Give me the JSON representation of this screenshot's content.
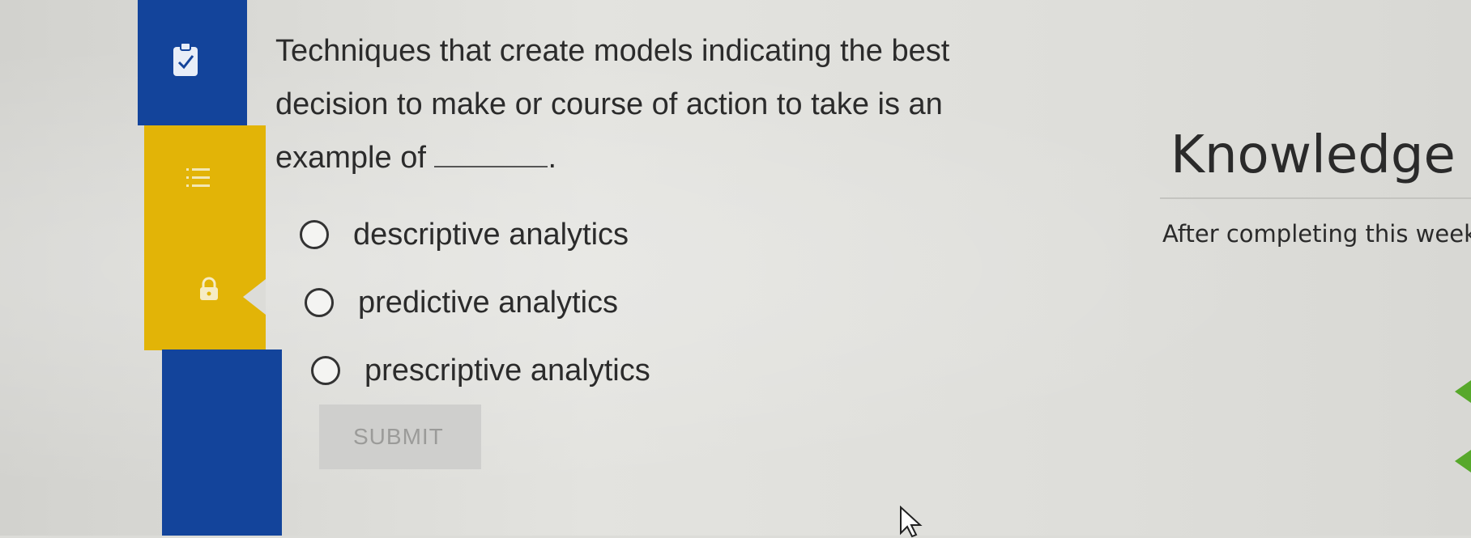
{
  "question": {
    "text_before_blank": "Techniques that create models indicating the best decision to make or course of action to take is an example of",
    "text_after_blank": "."
  },
  "options": [
    {
      "label": "descriptive analytics",
      "selected": false
    },
    {
      "label": "predictive analytics",
      "selected": false
    },
    {
      "label": "prescriptive analytics",
      "selected": false
    }
  ],
  "submit": {
    "label": "SUBMIT",
    "enabled": false
  },
  "side_panel": {
    "title": "Knowledge",
    "text": "After completing this week"
  },
  "sidebar": {
    "icons": [
      "clipboard-check-icon",
      "list-icon",
      "lock-icon"
    ]
  },
  "colors": {
    "sidebar_blue": "#13449b",
    "sidebar_yellow": "#e2b407",
    "accent_green": "#57a82b"
  }
}
